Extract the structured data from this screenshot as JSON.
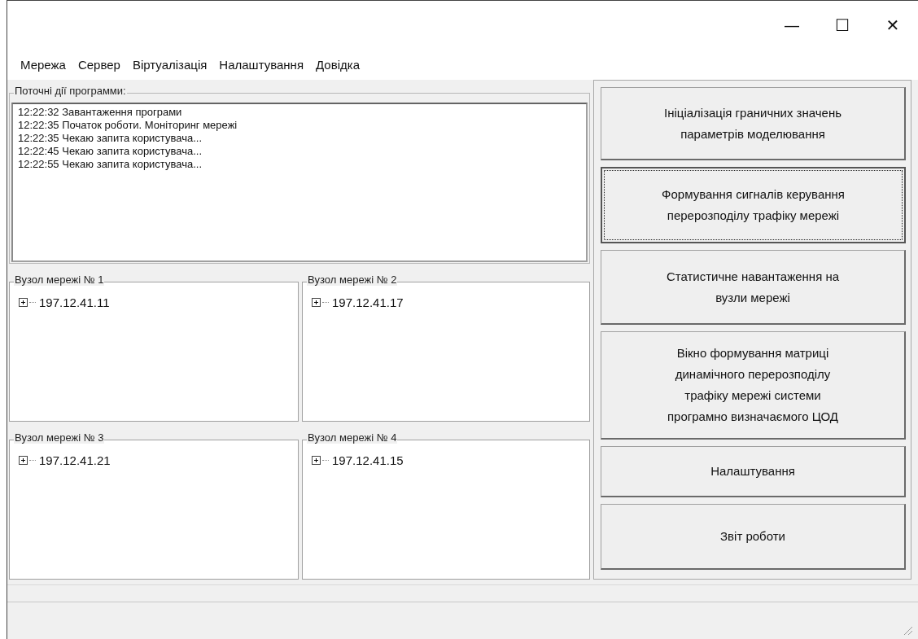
{
  "window": {
    "controls": [
      "—",
      "☐",
      "✕"
    ]
  },
  "menu": [
    "Мережа",
    "Сервер",
    "Віртуалізація",
    "Налаштування",
    "Довідка"
  ],
  "log": {
    "title": "Поточні дії программи:",
    "lines": [
      "12:22:32 Завантаження програми",
      "12:22:35 Початок роботи. Моніторинг мережі",
      "12:22:35 Чекаю запита користувача...",
      "12:22:45 Чекаю запита користувача...",
      "12:22:55 Чекаю запита користувача..."
    ]
  },
  "nodes": [
    {
      "title": "Вузол мережі № 1",
      "items": [
        {
          "label": "197.12.41.11",
          "expanded": false
        }
      ]
    },
    {
      "title": "Вузол мережі № 2",
      "items": [
        {
          "label": "197.12.41.17",
          "expanded": false
        }
      ]
    },
    {
      "title": "Вузол мережі № 3",
      "items": [
        {
          "label": "197.12.41.21",
          "expanded": false
        }
      ]
    },
    {
      "title": "Вузол мережі № 4",
      "items": [
        {
          "label": "197.12.41.15",
          "expanded": false
        }
      ]
    }
  ],
  "actions": [
    {
      "label": "Ініціалізація граничних значень\nпараметрів моделювання",
      "focused": false
    },
    {
      "label": "Формування сигналів керування\nперерозподілу трафіку мережі",
      "focused": true
    },
    {
      "label": "Статистичне навантаження на\nвузли мережі",
      "focused": false
    },
    {
      "label": "Вікно формування матриці\nдинамічного перерозподілу\nтрафіку мережі системи\nпрограмно визначаємого ЦОД",
      "focused": false
    },
    {
      "label": "Налаштування",
      "focused": false
    },
    {
      "label": "Звіт роботи",
      "focused": false
    }
  ]
}
